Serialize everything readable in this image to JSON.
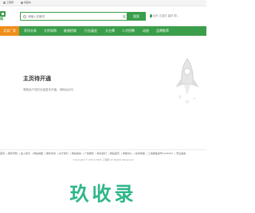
{
  "topbar": {
    "item1": "工程网",
    "item2": "收藏本"
  },
  "header": {
    "logo_text": "网",
    "search_placeholder": "请输入关键词",
    "search_category": "找工厂家",
    "search_button": "搜索",
    "location": "全市",
    "hotwords": "五金件  建材  铜..."
  },
  "nav": {
    "items": [
      "买卖厂家",
      "资讯头条",
      "大宗采购",
      "能源招商",
      "行业展会",
      "大企牌",
      "人才招聘",
      "动态",
      "品牌推荐"
    ]
  },
  "main": {
    "title": "主页待开通",
    "subtitle": "尊敬用户您的页面暂未开通，请稍后访问"
  },
  "footer": {
    "links": [
      "首页",
      "服务须知",
      "加入我们",
      "网站地图",
      "服务条款",
      "关于我们",
      "网站留言",
      "广告服务",
      "联系我们",
      "网站首页",
      "举报中心",
      "投诉举报",
      "工信部备案号1234567",
      "安全备案"
    ],
    "copyright": "Copyright © 2014-2024 工程网 All Rights Reserved"
  },
  "watermark": "玖收录",
  "colors": {
    "brand": "#3b9e4a",
    "accent": "#f08c1a",
    "watermark": "#2fb68a"
  }
}
